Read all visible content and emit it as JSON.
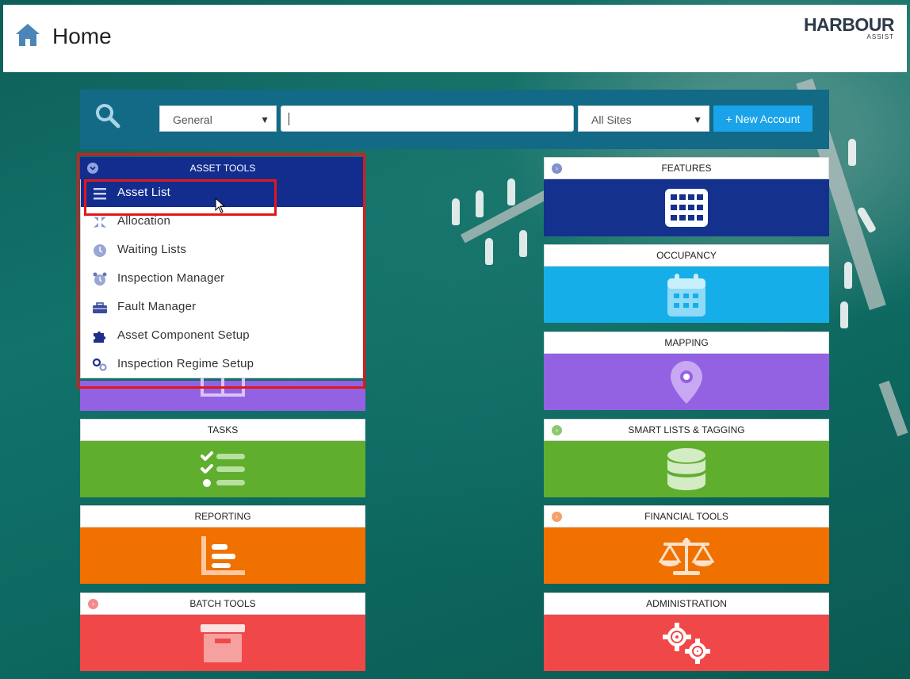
{
  "header": {
    "title": "Home",
    "logo_main": "HARBOUR",
    "logo_sub": "ASSIST"
  },
  "search": {
    "type_select": "General",
    "query": "",
    "site_select": "All Sites",
    "new_account": "+ New Account"
  },
  "asset_tools": {
    "title": "ASSET TOOLS",
    "items": [
      {
        "label": "Asset List",
        "icon": "list-icon",
        "active": true
      },
      {
        "label": "Allocation",
        "icon": "compress-icon"
      },
      {
        "label": "Waiting Lists",
        "icon": "clock-icon"
      },
      {
        "label": "Inspection Manager",
        "icon": "alarm-clock-icon"
      },
      {
        "label": "Fault Manager",
        "icon": "toolbox-icon"
      },
      {
        "label": "Asset Component Setup",
        "icon": "puzzle-icon"
      },
      {
        "label": "Inspection Regime Setup",
        "icon": "gears-icon"
      }
    ]
  },
  "tiles": {
    "features": {
      "title": "FEATURES",
      "color": "#13318d",
      "icon": "grid-icon"
    },
    "occupancy": {
      "title": "OCCUPANCY",
      "color": "#16aee8",
      "icon": "calendar-icon"
    },
    "mapping": {
      "title": "MAPPING",
      "color": "#9362e3",
      "icon": "map-pin-icon"
    },
    "tasks": {
      "title": "TASKS",
      "color": "#5fae2e",
      "icon": "checklist-icon"
    },
    "smart_lists": {
      "title": "SMART LISTS & TAGGING",
      "color": "#5fae2e",
      "icon": "database-icon"
    },
    "reporting": {
      "title": "REPORTING",
      "color": "#f07000",
      "icon": "bar-chart-icon"
    },
    "financial": {
      "title": "FINANCIAL TOOLS",
      "color": "#f07000",
      "icon": "scales-icon"
    },
    "batch": {
      "title": "BATCH TOOLS",
      "color": "#f04848",
      "icon": "archive-box-icon"
    },
    "administration": {
      "title": "ADMINISTRATION",
      "color": "#f04848",
      "icon": "cogs-icon"
    }
  }
}
